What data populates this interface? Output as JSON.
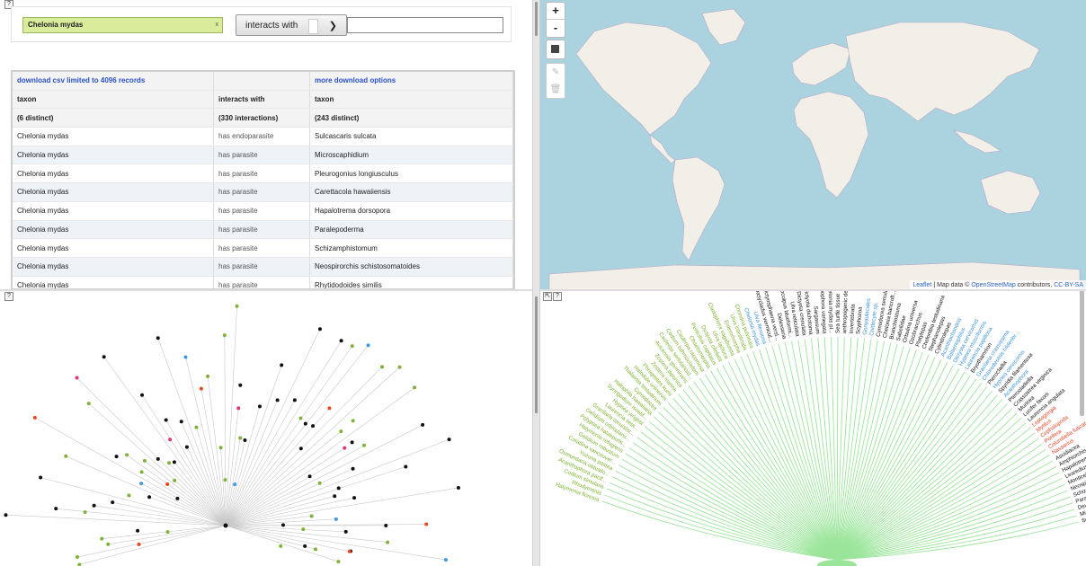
{
  "search": {
    "source_taxon": "Chelonia mydas",
    "clear_glyph": "x",
    "interaction_type": "interacts with",
    "target_taxon": ""
  },
  "table": {
    "download_csv": "download csv limited to 4096 records",
    "more_download": "more download options",
    "headers": [
      "taxon",
      "interacts with",
      "taxon"
    ],
    "counts": [
      "(6 distinct)",
      "(330 interactions)",
      "(243 distinct)"
    ],
    "rows": [
      [
        "Chelonia mydas",
        "has endoparasite",
        "Sulcascaris sulcata"
      ],
      [
        "Chelonia mydas",
        "has parasite",
        "Microscaphidium"
      ],
      [
        "Chelonia mydas",
        "has parasite",
        "Pleurogonius longiusculus"
      ],
      [
        "Chelonia mydas",
        "has parasite",
        "Carettacola hawaiiensis"
      ],
      [
        "Chelonia mydas",
        "has parasite",
        "Hapalotrema dorsopora"
      ],
      [
        "Chelonia mydas",
        "has parasite",
        "Paralepoderma"
      ],
      [
        "Chelonia mydas",
        "has parasite",
        "Schizamphistomum"
      ],
      [
        "Chelonia mydas",
        "has parasite",
        "Neospirorchis schistosomatoides"
      ],
      [
        "Chelonia mydas",
        "has parasite",
        "Rhytidodoides similis"
      ]
    ]
  },
  "map": {
    "zoom_in": "+",
    "zoom_out": "-",
    "edit_icon": "✎",
    "delete_icon": "🗑",
    "attribution_leaflet": "Leaflet",
    "attribution_mid": " | Map data © ",
    "attribution_osm": "OpenStreetMap",
    "attribution_end": " contributors, ",
    "attribution_license": "CC-BY-SA",
    "colors": {
      "sea": "#aad3df",
      "land": "#f2efe9",
      "border": "#b9a9c4"
    }
  },
  "panel_buttons": {
    "help": "?",
    "expand": "⇱"
  },
  "network": {
    "colors": {
      "black": "#111111",
      "green": "#7fb238",
      "blue": "#3d9be0",
      "red": "#ee4422",
      "pink": "#e0337a",
      "edge": "#c8c8c8"
    }
  },
  "tree": {
    "colors": {
      "branch": "#9be59b",
      "green_label": "#7ab42c",
      "blue_label": "#3a93e0",
      "red_label": "#ee4422",
      "black_label": "#111111"
    },
    "labels": [
      {
        "text": "Halymenia floresia",
        "c": "g"
      },
      {
        "text": "Rhodymenia",
        "c": "g"
      },
      {
        "text": "Codium simulans",
        "c": "g"
      },
      {
        "text": "Acanthophora pacif...",
        "c": "g"
      },
      {
        "text": "Osmundaria obtusilo...",
        "c": "g"
      },
      {
        "text": "Yuzuna pastea",
        "c": "g"
      },
      {
        "text": "Corallina vancouver...",
        "c": "g"
      },
      {
        "text": "Gelidium robustum",
        "c": "g"
      },
      {
        "text": "Halymenia refugiens",
        "c": "g"
      },
      {
        "text": "Polypsea hataspuns...",
        "c": "g"
      },
      {
        "text": "Gelidium orbiculans...",
        "c": "g"
      },
      {
        "text": "Gracilaria tenuistor...",
        "c": "g"
      },
      {
        "text": "Laurencia seta...",
        "c": "g"
      },
      {
        "text": "Hypnea wrightii",
        "c": "g"
      },
      {
        "text": "Syringodium isoetif...",
        "c": "g"
      },
      {
        "text": "Halophila hawaiiana",
        "c": "g"
      },
      {
        "text": "Cymodocea",
        "c": "g"
      },
      {
        "text": "Thalassia testudinum",
        "c": "g"
      },
      {
        "text": "Halodule uninervis",
        "c": "g"
      },
      {
        "text": "Phragmites kumi",
        "c": "g"
      },
      {
        "text": "Zostera marina",
        "c": "g"
      },
      {
        "text": "Zostera japonica",
        "c": "g"
      },
      {
        "text": "Avicennia germinans",
        "c": "g"
      },
      {
        "text": "Caulerpa sertularioid...",
        "c": "g"
      },
      {
        "text": "Codium isthmocladum",
        "c": "g"
      },
      {
        "text": "Caulerpa racemosa",
        "c": "g"
      },
      {
        "text": "Chaetomorpha",
        "c": "g"
      },
      {
        "text": "Penicillus capitatus",
        "c": "g"
      },
      {
        "text": "Dictyota ciliolata",
        "c": "g"
      },
      {
        "text": "Ulva lactuca",
        "c": "g"
      },
      {
        "text": "Cladophora vagabunda",
        "c": "g"
      },
      {
        "text": "Enteromorpha",
        "c": "g"
      },
      {
        "text": "Ulva intestinalis",
        "c": "g"
      },
      {
        "text": "Chondria pulvinata",
        "c": "g"
      },
      {
        "text": "Chelonia mydas",
        "c": "b"
      },
      {
        "text": "Ulva flexuosa",
        "c": "b"
      },
      {
        "text": "Dasycladus vermicul...",
        "c": "k"
      },
      {
        "text": "Dictyosphaeria versl...",
        "c": "k"
      },
      {
        "text": "Delesseria",
        "c": "k"
      },
      {
        "text": "Dermocolpus blueformi...",
        "c": "k"
      },
      {
        "text": "Ulva reticulata",
        "c": "k"
      },
      {
        "text": "Dictyota crenulata",
        "c": "k"
      },
      {
        "text": "Dictyota dichotoma",
        "c": "k"
      },
      {
        "text": "Sargassum",
        "c": "k"
      },
      {
        "text": "Lobophora variegata",
        "c": "k"
      },
      {
        "text": "Chelonia mydas pl...",
        "c": "k"
      },
      {
        "text": "Sea turtle tissue",
        "c": "k"
      },
      {
        "text": "anthropogenic debris",
        "c": "k"
      },
      {
        "text": "Invertebrata",
        "c": "k"
      },
      {
        "text": "Scyphozoa",
        "c": "k"
      },
      {
        "text": "Gonyaulacales",
        "c": "b"
      },
      {
        "text": "Cnidocyte sp.",
        "c": "b"
      },
      {
        "text": "Cymodocea serrulata",
        "c": "k"
      },
      {
        "text": "Chelonia bancroft...",
        "c": "k"
      },
      {
        "text": "Branchiostoma",
        "c": "k"
      },
      {
        "text": "Sabellidae",
        "c": "k"
      },
      {
        "text": "Orbulina universa",
        "c": "k"
      },
      {
        "text": "Ozobranchus",
        "c": "k"
      },
      {
        "text": "Platylepas",
        "c": "k"
      },
      {
        "text": "Chelonibia testudinaria",
        "c": "k"
      },
      {
        "text": "Stephanolepas",
        "c": "k"
      },
      {
        "text": "Cylindrolepas",
        "c": "k"
      },
      {
        "text": "Acanthochondria",
        "c": "b"
      },
      {
        "text": "Balaenophilus",
        "c": "b"
      },
      {
        "text": "Dictyota cervicornis",
        "c": "b"
      },
      {
        "text": "Hypnea musciformis",
        "c": "b"
      },
      {
        "text": "Laurencia papillosa",
        "c": "b"
      },
      {
        "text": "Bryothamnion",
        "c": "k"
      },
      {
        "text": "Gracilaria crassissima",
        "c": "b"
      },
      {
        "text": "Chlorodesmis hildenbr...",
        "c": "b"
      },
      {
        "text": "Pterocladia",
        "c": "k"
      },
      {
        "text": "Hypnea cervicornis",
        "c": "b"
      },
      {
        "text": "Spyridia filamentosa",
        "c": "k"
      },
      {
        "text": "Acanthophora",
        "c": "b"
      },
      {
        "text": "Pterocladiella",
        "c": "k"
      },
      {
        "text": "Crassostrea virginica",
        "c": "k"
      },
      {
        "text": "Muricea",
        "c": "k"
      },
      {
        "text": "Lucifer faxoni",
        "c": "k"
      },
      {
        "text": "Laurencia angulata",
        "c": "k"
      },
      {
        "text": "Leptogorgia",
        "c": "r"
      },
      {
        "text": "Mytilus",
        "c": "r"
      },
      {
        "text": "Cephalopoda",
        "c": "r"
      },
      {
        "text": "Porifera",
        "c": "r"
      },
      {
        "text": "Columbella fuscata",
        "c": "r"
      },
      {
        "text": "Nassarius",
        "c": "r"
      },
      {
        "text": "Ascidiacea",
        "c": "k"
      },
      {
        "text": "Amphiorchis amphio...",
        "c": "k"
      },
      {
        "text": "Hapalotrema dorso...",
        "c": "k"
      },
      {
        "text": "Learedius learedi",
        "c": "k"
      },
      {
        "text": "Monticellius similis",
        "c": "k"
      },
      {
        "text": "Neospirorchis sch...",
        "c": "k"
      },
      {
        "text": "Schizamphistomum",
        "c": "k"
      },
      {
        "text": "Paramphistomum",
        "c": "k"
      },
      {
        "text": "Deuterobaris proteus",
        "c": "k"
      },
      {
        "text": "Microscaphidium",
        "c": "k"
      },
      {
        "text": "Schizamphistoma",
        "c": "k"
      }
    ]
  }
}
